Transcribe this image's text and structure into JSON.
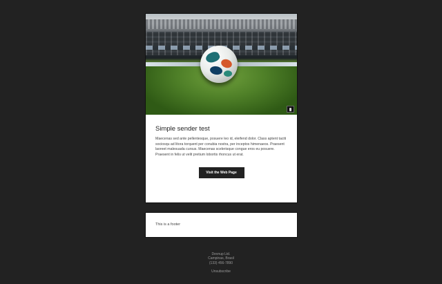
{
  "email": {
    "title": "Simple sender test",
    "body": "Maecenas sed ante pellentesque, posuere leo id, eleifend dolor. Class aptent taciti sociosqu ad litora torquent per conubia nostra, per inceptos himenaeos. Praesent laoreet malesuada cursus. Maecenas scelerisque congue eros eu posuere. Praesent in felis ut velit pretium lobortis rhoncus ut erat.",
    "cta_label": "Visit the Web Page"
  },
  "footer": {
    "text": "This is a footer"
  },
  "address": {
    "company": "Devnup Ltd.",
    "city": "Campinas, Brasil",
    "phone": "(133) 456-7890"
  },
  "unsubscribe_label": "Unsubscribe",
  "colors": {
    "background": "#222222",
    "card": "#ffffff",
    "button": "#222222"
  }
}
